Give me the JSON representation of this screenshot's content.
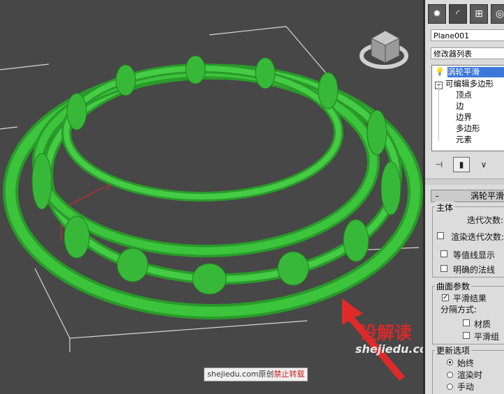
{
  "scene": {
    "object_color": "#2fae2f",
    "arrow_color": "#e02a2a"
  },
  "panel": {
    "tabs": [
      "create-icon",
      "modify-icon",
      "hierarchy-icon",
      "motion-icon"
    ],
    "object_name": "Plane001",
    "modifier_list": "修改器列表",
    "stack": [
      {
        "label": "涡轮平滑",
        "level": 0,
        "selected": true
      },
      {
        "label": "可编辑多边形",
        "level": 0,
        "selected": false
      },
      {
        "label": "顶点",
        "level": 1,
        "selected": false
      },
      {
        "label": "边",
        "level": 1,
        "selected": false
      },
      {
        "label": "边界",
        "level": 1,
        "selected": false
      },
      {
        "label": "多边形",
        "level": 1,
        "selected": false
      },
      {
        "label": "元素",
        "level": 1,
        "selected": false
      }
    ],
    "turbosmooth": {
      "rollout_title": "涡轮平滑",
      "rollout_toggle": "-",
      "main_group": "主体",
      "iterations_label": "迭代次数:",
      "render_iters_label": "渲染迭代次数:",
      "isoline_label": "等值线显示",
      "explicit_normals_label": "明确的法线",
      "surface_group": "曲面参数",
      "smooth_result_label": "平滑结果",
      "smooth_result_checked": true,
      "separate_by_label": "分隔方式:",
      "materials_label": "材质",
      "smoothing_groups_label": "平滑组",
      "update_group": "更新选项",
      "always_label": "始终",
      "when_rendering_label": "渲染时",
      "manually_label": "手动",
      "update_selected": "始终"
    }
  },
  "watermark": {
    "logo_text": "设解读",
    "url": "shejiedu.com",
    "bar_prefix": "shejiedu.com原创",
    "bar_warning": "禁止转载"
  }
}
